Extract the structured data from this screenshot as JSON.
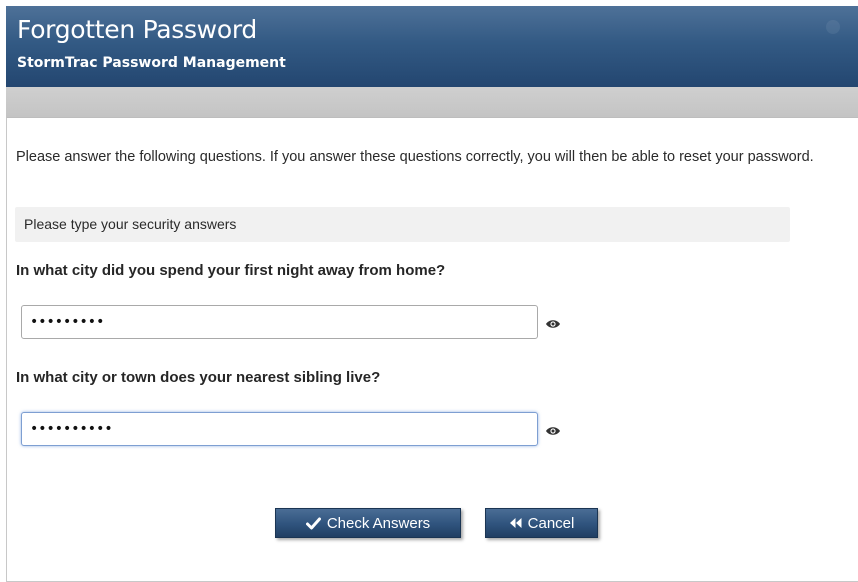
{
  "header": {
    "title": "Forgotten Password",
    "subtitle": "StormTrac Password Management"
  },
  "main": {
    "intro": "Please answer the following questions. If you answer these questions correctly, you will then be able to reset your password.",
    "section_label": "Please type your security answers",
    "questions": [
      {
        "label": "In what city did you spend your first night away from home?",
        "value": "•••••••••",
        "toggle_icon": "eye-icon"
      },
      {
        "label": "In what city or town does your nearest sibling live?",
        "value": "••••••••••",
        "toggle_icon": "eye-icon",
        "focused": true
      }
    ]
  },
  "buttons": {
    "check_label": "Check Answers",
    "check_icon": "checkmark-icon",
    "cancel_label": "Cancel",
    "cancel_icon": "rewind-icon"
  },
  "colors": {
    "header": "#2e5281",
    "button": "#2f537d",
    "toolbar": "#c9c9c9",
    "section_bar": "#f1f1f1"
  }
}
